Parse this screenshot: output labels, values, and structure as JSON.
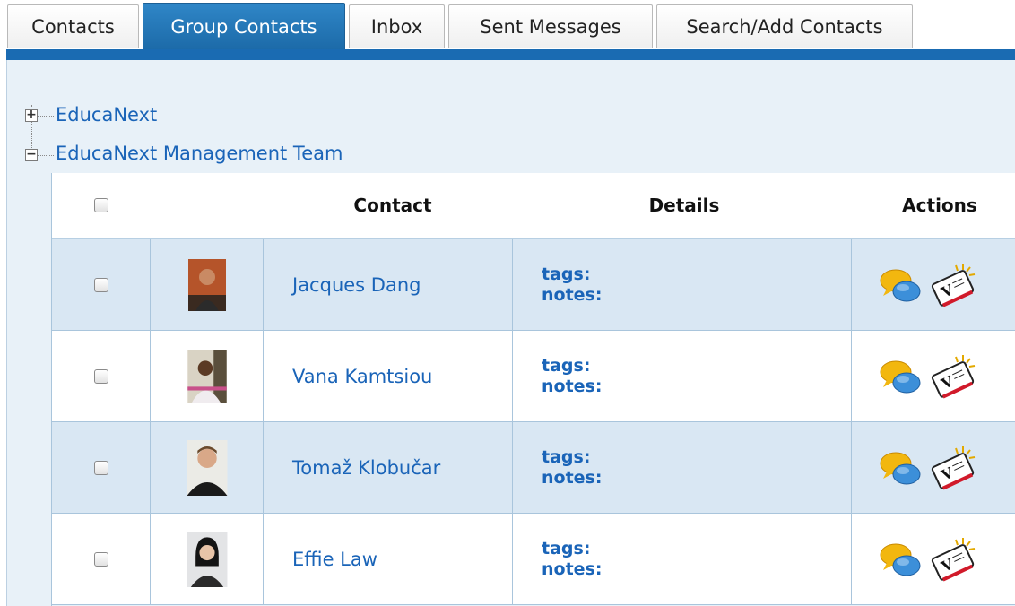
{
  "tabs": [
    {
      "label": "Contacts",
      "active": false
    },
    {
      "label": "Group Contacts",
      "active": true
    },
    {
      "label": "Inbox",
      "active": false
    },
    {
      "label": "Sent Messages",
      "active": false
    },
    {
      "label": "Search/Add Contacts",
      "active": false
    }
  ],
  "tree": {
    "groups": [
      {
        "label": "EducaNext",
        "expanded": false,
        "expander": "+"
      },
      {
        "label": "EducaNext Management Team",
        "expanded": true,
        "expander": "−"
      }
    ]
  },
  "table": {
    "columns": {
      "contact": "Contact",
      "details": "Details",
      "actions": "Actions"
    },
    "rows": [
      {
        "name": "Jacques Dang",
        "tags_label": "tags:",
        "notes_label": "notes:",
        "avatar": "avatar-photo-jacques"
      },
      {
        "name": "Vana Kamtsiou",
        "tags_label": "tags:",
        "notes_label": "notes:",
        "avatar": "avatar-photo-vana"
      },
      {
        "name": "Tomaž Klobučar",
        "tags_label": "tags:",
        "notes_label": "notes:",
        "avatar": "avatar-photo-tomaz"
      },
      {
        "name": "Effie Law",
        "tags_label": "tags:",
        "notes_label": "notes:",
        "avatar": "avatar-photo-effie"
      }
    ],
    "action_icons": [
      "chat-bubbles-icon",
      "vcard-icon"
    ]
  },
  "colors": {
    "accent": "#1a6bb2",
    "link": "#1a64b8",
    "panel_bg": "#e8f1f8",
    "row_alt": "#d9e7f3"
  }
}
